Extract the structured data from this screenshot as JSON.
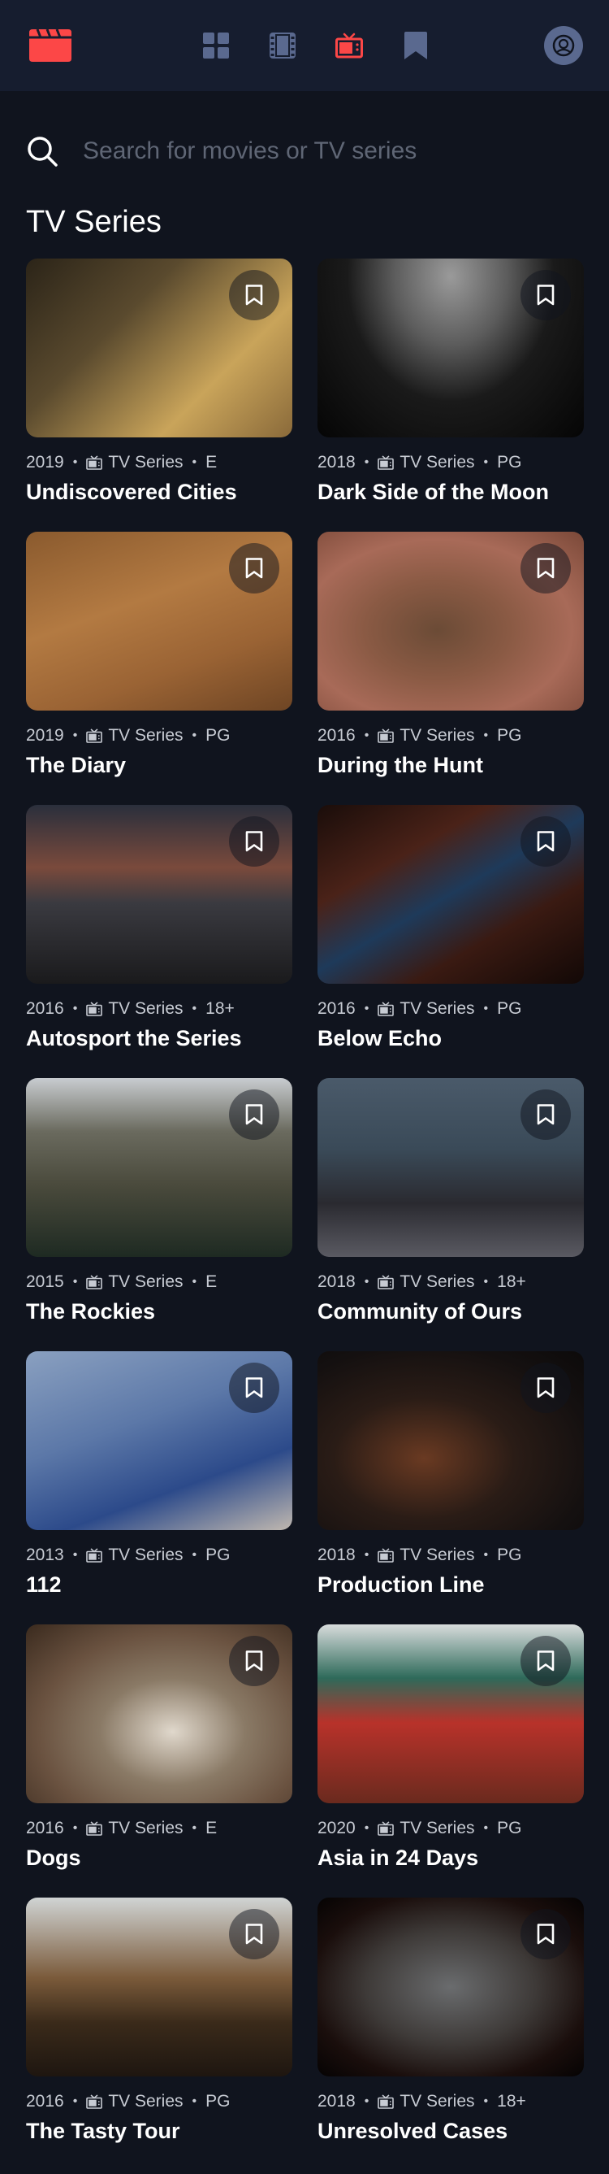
{
  "app": {
    "colors": {
      "background": "#10141E",
      "header": "#161D2F",
      "accent": "#FC4747",
      "nav_inactive": "#5A698F"
    },
    "logo_icon": "movie-clapperboard-icon"
  },
  "nav": {
    "items": [
      {
        "name": "home",
        "icon": "grid-icon",
        "active": false
      },
      {
        "name": "movies",
        "icon": "film-icon",
        "active": false
      },
      {
        "name": "tv-series",
        "icon": "tv-icon",
        "active": true
      },
      {
        "name": "bookmarked",
        "icon": "bookmark-icon",
        "active": false
      }
    ],
    "avatar_icon": "user-avatar-icon"
  },
  "search": {
    "placeholder": "Search for movies or TV series",
    "value": ""
  },
  "section": {
    "title": "TV Series"
  },
  "cards": [
    {
      "year": "2019",
      "category": "TV Series",
      "rating": "E",
      "title": "Undiscovered Cities",
      "bookmarked": false
    },
    {
      "year": "2018",
      "category": "TV Series",
      "rating": "PG",
      "title": "Dark Side of the Moon",
      "bookmarked": false
    },
    {
      "year": "2019",
      "category": "TV Series",
      "rating": "PG",
      "title": "The Diary",
      "bookmarked": false
    },
    {
      "year": "2016",
      "category": "TV Series",
      "rating": "PG",
      "title": "During the Hunt",
      "bookmarked": false
    },
    {
      "year": "2016",
      "category": "TV Series",
      "rating": "18+",
      "title": "Autosport the Series",
      "bookmarked": false
    },
    {
      "year": "2016",
      "category": "TV Series",
      "rating": "PG",
      "title": "Below Echo",
      "bookmarked": false
    },
    {
      "year": "2015",
      "category": "TV Series",
      "rating": "E",
      "title": "The Rockies",
      "bookmarked": false
    },
    {
      "year": "2018",
      "category": "TV Series",
      "rating": "18+",
      "title": "Community of Ours",
      "bookmarked": false
    },
    {
      "year": "2013",
      "category": "TV Series",
      "rating": "PG",
      "title": "112",
      "bookmarked": false
    },
    {
      "year": "2018",
      "category": "TV Series",
      "rating": "PG",
      "title": "Production Line",
      "bookmarked": false
    },
    {
      "year": "2016",
      "category": "TV Series",
      "rating": "E",
      "title": "Dogs",
      "bookmarked": false
    },
    {
      "year": "2020",
      "category": "TV Series",
      "rating": "PG",
      "title": "Asia in 24 Days",
      "bookmarked": false
    },
    {
      "year": "2016",
      "category": "TV Series",
      "rating": "PG",
      "title": "The Tasty Tour",
      "bookmarked": false
    },
    {
      "year": "2018",
      "category": "TV Series",
      "rating": "18+",
      "title": "Unresolved Cases",
      "bookmarked": false
    }
  ]
}
